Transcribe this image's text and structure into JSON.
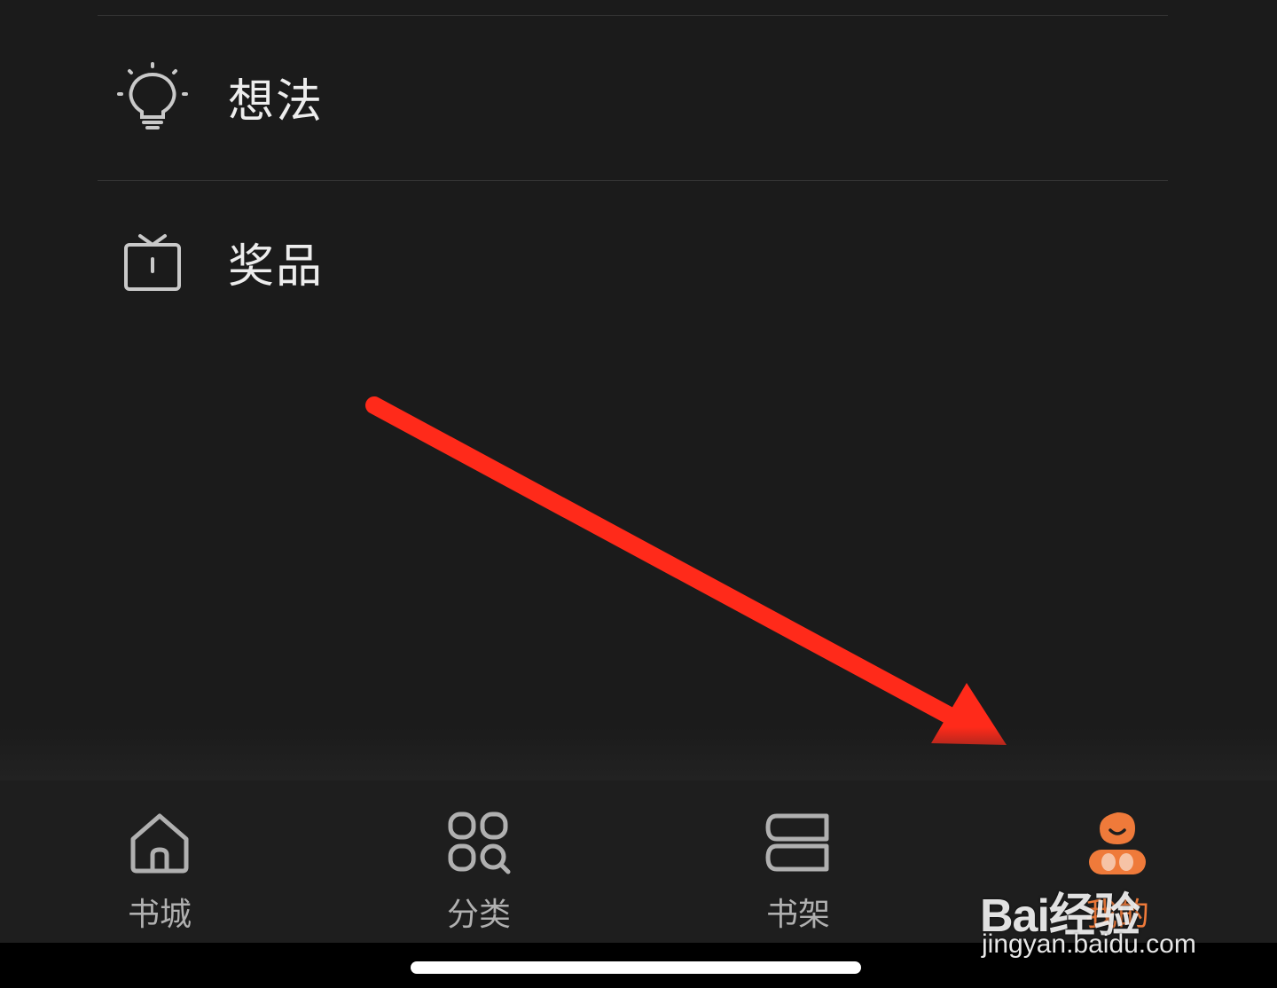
{
  "menu": {
    "items": [
      {
        "label": "想法",
        "icon": "lightbulb-icon"
      },
      {
        "label": "奖品",
        "icon": "gift-icon"
      }
    ]
  },
  "tabbar": {
    "tabs": [
      {
        "label": "书城",
        "icon": "home-icon",
        "active": false
      },
      {
        "label": "分类",
        "icon": "category-grid-icon",
        "active": false
      },
      {
        "label": "书架",
        "icon": "bookshelf-icon",
        "active": false
      },
      {
        "label": "我的",
        "icon": "profile-mascot-icon",
        "active": true
      }
    ]
  },
  "watermark": {
    "brand": "Bai经验",
    "url": "jingyan.baidu.com"
  },
  "colors": {
    "background": "#1b1b1b",
    "accent": "#ef7a3a",
    "annotation_arrow": "#ff2a1a"
  }
}
